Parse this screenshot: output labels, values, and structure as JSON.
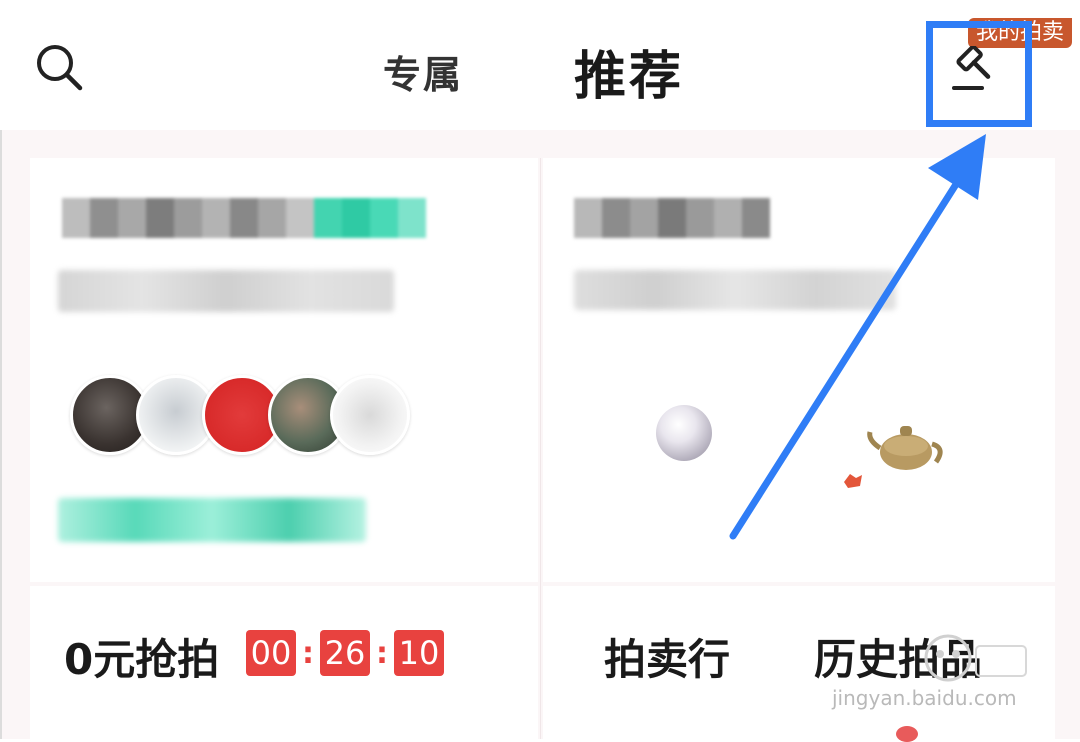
{
  "header": {
    "tabs": [
      {
        "label": "专属"
      },
      {
        "label": "推荐"
      }
    ],
    "my_auction_badge": "我的拍卖"
  },
  "bottom": {
    "flash_title": "0元抢拍",
    "timer": {
      "hours": "00",
      "minutes": "26",
      "seconds": "10"
    },
    "auction_house": "拍卖行",
    "history_items": "历史拍品"
  },
  "watermark": {
    "text": "jingyan.baidu.com"
  },
  "colors": {
    "highlight": "#2f7df6",
    "timer": "#e8423f",
    "badge": "#c8572d",
    "accent_green": "#3fd3b0"
  },
  "icons": [
    "search-icon",
    "hammer-icon",
    "arrow-annotation"
  ]
}
